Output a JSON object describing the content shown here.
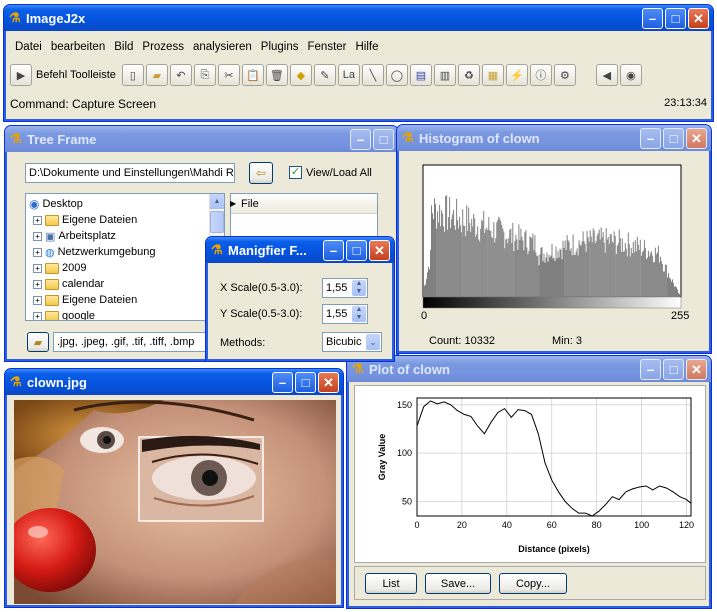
{
  "main_window": {
    "title": "ImageJ2x",
    "menu": [
      "Datei",
      "bearbeiten",
      "Bild",
      "Prozess",
      "analysieren",
      "Plugins",
      "Fenster",
      "Hilfe"
    ],
    "toolbar_label": "Befehl Toolleiste",
    "status_command": "Command: Capture Screen",
    "status_time": "23:13:34"
  },
  "tree_frame": {
    "title": "Tree Frame",
    "path_value": "D:\\Dokumente und Einstellungen\\Mahdi Ra",
    "viewload_label": "View/Load All",
    "viewload_checked": true,
    "file_header": "File",
    "items": [
      "Desktop",
      "Eigene Dateien",
      "Arbeitsplatz",
      "Netzwerkumgebung",
      "2009",
      "calendar",
      "Eigene Dateien",
      "google"
    ],
    "filter_value": ".jpg, .jpeg, .gif, .tif, .tiff, .bmp"
  },
  "magnifier": {
    "title": "Manigfier F...",
    "x_label": "X Scale(0.5-3.0):",
    "x_value": "1,55",
    "y_label": "Y Scale(0.5-3.0):",
    "y_value": "1,55",
    "methods_label": "Methods:",
    "methods_value": "Bicubic"
  },
  "histogram": {
    "title": "Histogram of clown",
    "min_axis": "0",
    "max_axis": "255",
    "count": "Count: 10332",
    "min": "Min: 3"
  },
  "clown_window": {
    "title": "clown.jpg"
  },
  "plot_window": {
    "title": "Plot of clown",
    "ylabel": "Gray Value",
    "xlabel": "Distance (pixels)",
    "buttons": [
      "List",
      "Save...",
      "Copy..."
    ]
  },
  "chart_data": {
    "type": "line",
    "xlabel": "Distance (pixels)",
    "ylabel": "Gray Value",
    "xlim": [
      0,
      122
    ],
    "ylim": [
      35,
      157
    ],
    "xticks": [
      0,
      20,
      40,
      60,
      80,
      100,
      120
    ],
    "yticks": [
      50,
      100,
      150
    ],
    "x": [
      0,
      3,
      6,
      9,
      12,
      15,
      18,
      21,
      24,
      27,
      30,
      33,
      36,
      39,
      42,
      45,
      48,
      51,
      54,
      57,
      60,
      63,
      66,
      69,
      72,
      75,
      78,
      81,
      84,
      87,
      90,
      93,
      96,
      99,
      102,
      105,
      108,
      111,
      114,
      117,
      120,
      122
    ],
    "y": [
      128,
      148,
      154,
      151,
      153,
      150,
      144,
      140,
      138,
      128,
      120,
      132,
      142,
      146,
      137,
      145,
      144,
      140,
      120,
      90,
      72,
      60,
      50,
      43,
      38,
      38,
      35,
      40,
      47,
      55,
      52,
      60,
      63,
      65,
      66,
      62,
      66,
      64,
      60,
      55,
      52,
      48
    ]
  },
  "colors": {
    "title_active": "#0553dc",
    "title_inactive": "#7a99e0",
    "window_bg": "#ece9d8",
    "histogram_bar": "#808080"
  }
}
